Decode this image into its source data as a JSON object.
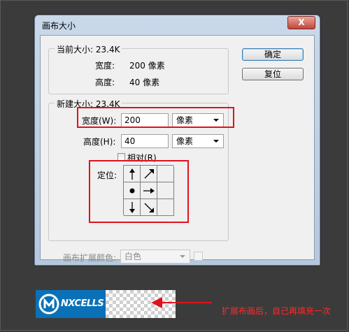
{
  "dialog": {
    "title": "画布大小",
    "close_label": "X",
    "current_size": {
      "legend": "当前大小: 23.4K",
      "width_label": "宽度:",
      "width_value": "200 像素",
      "height_label": "高度:",
      "height_value": "40 像素"
    },
    "new_size": {
      "legend": "新建大小: 23.4K",
      "width_label": "宽度(W):",
      "width_value": "200",
      "width_unit": "像素",
      "height_label": "高度(H):",
      "height_value": "40",
      "height_unit": "像素",
      "relative_label": "相对(R)",
      "anchor_label": "定位:"
    },
    "canvas_ext_color": {
      "label": "画布扩展颜色:",
      "value": "白色"
    },
    "buttons": {
      "ok": "确定",
      "reset": "复位"
    }
  },
  "logo": {
    "text": "NXCELLS"
  },
  "annotation": {
    "text": "扩展布画后，自己再填充一次",
    "color": "#e0121b"
  },
  "icons": [
    "close-icon",
    "dropdown-arrow-icon",
    "arrow-up-icon",
    "arrow-up-right-icon",
    "anchor-dot-icon",
    "arrow-right-icon",
    "arrow-down-icon",
    "arrow-down-right-icon",
    "left-arrow-icon"
  ]
}
